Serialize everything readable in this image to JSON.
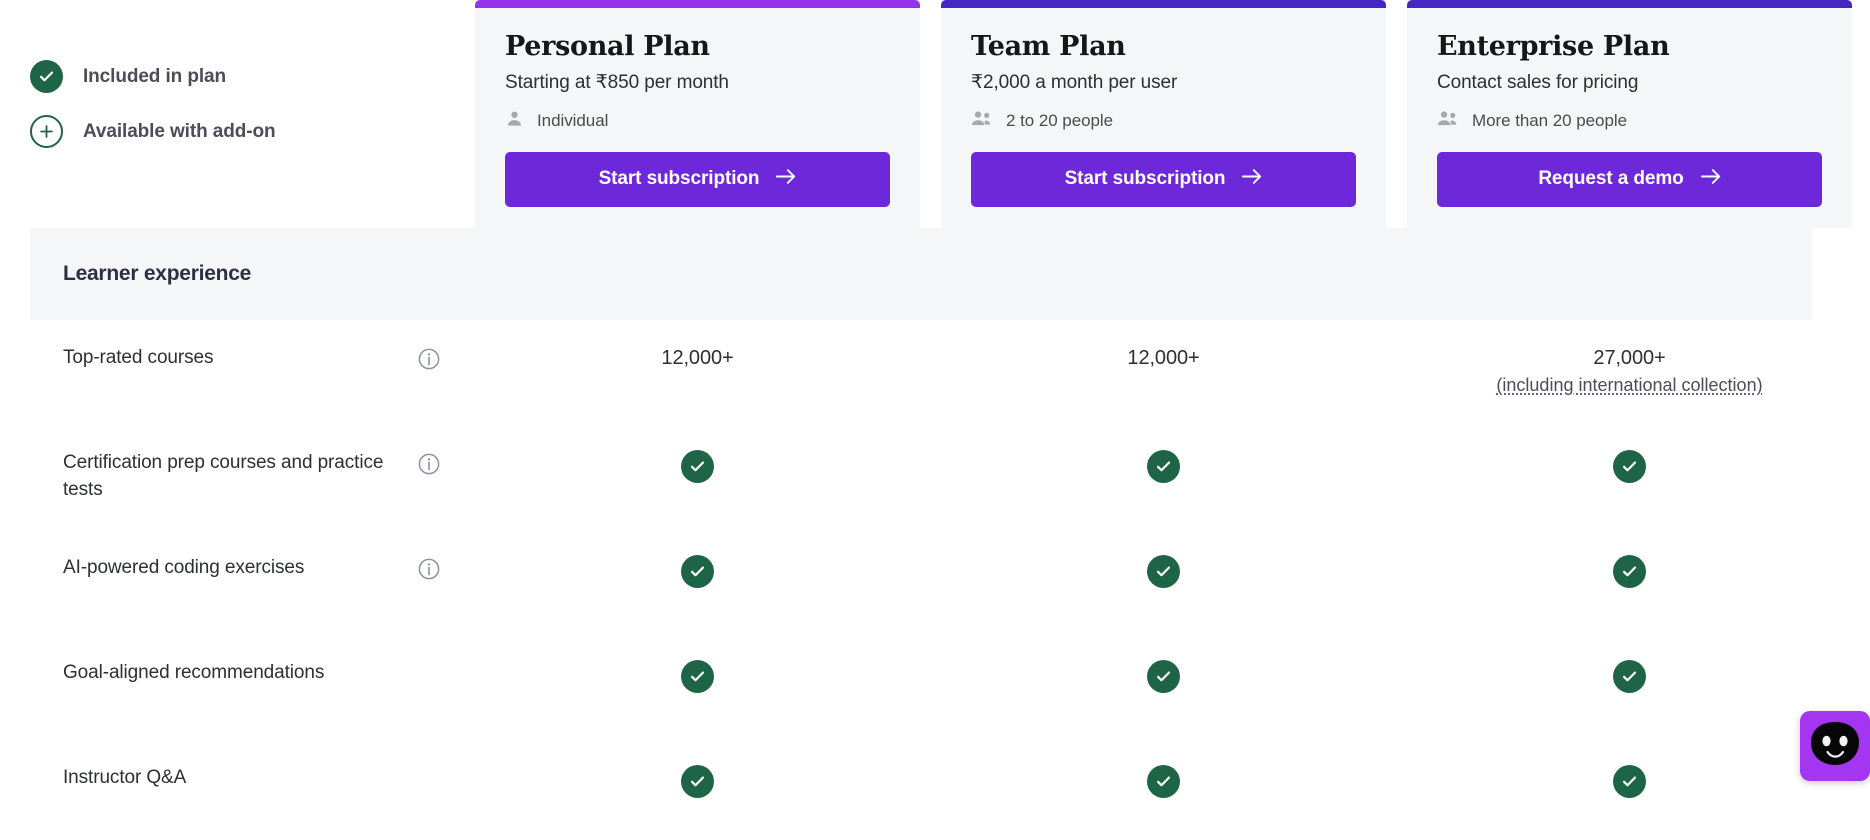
{
  "legend": {
    "items": [
      {
        "icon": "check-circle-filled-icon",
        "label": "Included in plan"
      },
      {
        "icon": "plus-circle-outline-icon",
        "label": "Available with add-on"
      }
    ]
  },
  "plans": [
    {
      "name": "Personal Plan",
      "price": "Starting at ₹850 per month",
      "audience": "Individual",
      "audience_icon": "person-icon",
      "cta": "Start subscription",
      "cta_icon": "arrow-right-icon",
      "accent": "#9333ea",
      "cta_color": "#6d28d9"
    },
    {
      "name": "Team Plan",
      "price": "₹2,000 a month per user",
      "audience": "2 to 20 people",
      "audience_icon": "people-icon",
      "cta": "Start subscription",
      "cta_icon": "arrow-right-icon",
      "accent": "#4527c4",
      "cta_color": "#6d28d9"
    },
    {
      "name": "Enterprise Plan",
      "price": "Contact sales for pricing",
      "audience": "More than 20 people",
      "audience_icon": "people-icon",
      "cta": "Request a demo",
      "cta_icon": "arrow-right-icon",
      "accent": "#4527c4",
      "cta_color": "#6d28d9"
    }
  ],
  "section": {
    "title": "Learner experience"
  },
  "features": [
    {
      "name": "Top-rated courses",
      "has_info": true,
      "cells": [
        {
          "type": "text",
          "value": "12,000+"
        },
        {
          "type": "text",
          "value": "12,000+"
        },
        {
          "type": "text",
          "value": "27,000+",
          "sub": "(including international collection)"
        }
      ]
    },
    {
      "name": "Certification prep courses and practice tests",
      "has_info": true,
      "cells": [
        {
          "type": "check"
        },
        {
          "type": "check"
        },
        {
          "type": "check"
        }
      ]
    },
    {
      "name": "AI-powered coding exercises",
      "has_info": true,
      "cells": [
        {
          "type": "check"
        },
        {
          "type": "check"
        },
        {
          "type": "check"
        }
      ]
    },
    {
      "name": "Goal-aligned recommendations",
      "has_info": false,
      "cells": [
        {
          "type": "check"
        },
        {
          "type": "check"
        },
        {
          "type": "check"
        }
      ]
    },
    {
      "name": "Instructor Q&A",
      "has_info": false,
      "cells": [
        {
          "type": "check"
        },
        {
          "type": "check"
        },
        {
          "type": "check"
        }
      ]
    }
  ],
  "chat": {
    "icon": "chat-bot-smiley-icon",
    "color": "#a435f0"
  }
}
